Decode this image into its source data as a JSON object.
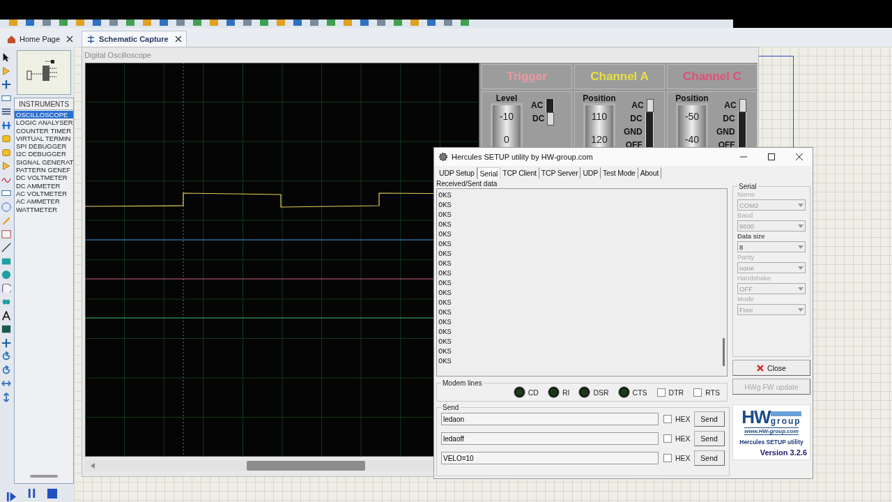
{
  "tabs": [
    {
      "label": "Home Page",
      "selected": false
    },
    {
      "label": "Schematic Capture",
      "selected": true
    }
  ],
  "instruments": {
    "title": "INSTRUMENTS",
    "items": [
      {
        "label": "OSCILLOSCOPE",
        "selected": true
      },
      {
        "label": "LOGIC ANALYSER",
        "selected": false
      },
      {
        "label": "COUNTER TIMER",
        "selected": false
      },
      {
        "label": "VIRTUAL TERMIN",
        "selected": false
      },
      {
        "label": "SPI DEBUGGER",
        "selected": false
      },
      {
        "label": "I2C DEBUGGER",
        "selected": false
      },
      {
        "label": "SIGNAL GENERAT",
        "selected": false
      },
      {
        "label": "PATTERN GENEF",
        "selected": false
      },
      {
        "label": "DC VOLTMETER",
        "selected": false
      },
      {
        "label": "DC AMMETER",
        "selected": false
      },
      {
        "label": "AC VOLTMETER",
        "selected": false
      },
      {
        "label": "AC AMMETER",
        "selected": false
      },
      {
        "label": "WATTMETER",
        "selected": false
      }
    ]
  },
  "oscilloscope": {
    "title": "Digital Oscilloscope",
    "panels": [
      {
        "title": "Trigger",
        "color": "#e89aa0",
        "knob_label": "Level",
        "scale": [
          "-10",
          "0"
        ],
        "coupling": [
          {
            "label": "AC",
            "selected": false
          },
          {
            "label": "DC",
            "selected": true
          }
        ]
      },
      {
        "title": "Channel A",
        "color": "#e8e040",
        "knob_label": "Position",
        "scale": [
          "110",
          "120"
        ],
        "coupling": [
          {
            "label": "AC",
            "selected": true
          },
          {
            "label": "DC",
            "selected": false
          },
          {
            "label": "GND",
            "selected": false
          },
          {
            "label": "OFF",
            "selected": false
          }
        ]
      },
      {
        "title": "Channel C",
        "color": "#e0507a",
        "knob_label": "Position",
        "scale": [
          "-50",
          "-40"
        ],
        "coupling": [
          {
            "label": "AC",
            "selected": true
          },
          {
            "label": "DC",
            "selected": false
          },
          {
            "label": "GND",
            "selected": false
          },
          {
            "label": "OFF",
            "selected": false
          }
        ]
      }
    ]
  },
  "hercules": {
    "title": "Hercules SETUP utility by HW-group.com",
    "tabs": [
      {
        "label": "UDP Setup",
        "selected": false
      },
      {
        "label": "Serial",
        "selected": true
      },
      {
        "label": "TCP Client",
        "selected": false
      },
      {
        "label": "TCP Server",
        "selected": false
      },
      {
        "label": "UDP",
        "selected": false
      },
      {
        "label": "Test Mode",
        "selected": false
      },
      {
        "label": "About",
        "selected": false
      }
    ],
    "received_label": "Received/Sent data",
    "received_lines": [
      "OKS",
      "OKS",
      "OKS",
      "OKS",
      "OKS",
      "OKS",
      "OKS",
      "OKS",
      "OKS",
      "OKS",
      "OKS",
      "OKS",
      "OKS",
      "OKS",
      "OKS",
      "OKS",
      "OKS",
      "OKS"
    ],
    "serial": {
      "title": "Serial",
      "fields": [
        {
          "label": "Name",
          "value": "COM2",
          "disabled": true
        },
        {
          "label": "Baud",
          "value": "9600",
          "disabled": true
        },
        {
          "label": "Data size",
          "value": "8",
          "disabled": false
        },
        {
          "label": "Parity",
          "value": "none",
          "disabled": true
        },
        {
          "label": "Handshake",
          "value": "OFF",
          "disabled": true
        },
        {
          "label": "Mode",
          "value": "Free",
          "disabled": true
        }
      ]
    },
    "close_button": "Close",
    "fw_button": {
      "label": "HWg FW update",
      "disabled": true
    },
    "modem_lines": {
      "title": "Modem lines",
      "indicators": [
        {
          "kind": "led",
          "label": "CD"
        },
        {
          "kind": "led",
          "label": "RI"
        },
        {
          "kind": "led",
          "label": "DSR"
        },
        {
          "kind": "led",
          "label": "CTS"
        },
        {
          "kind": "checkbox",
          "label": "DTR",
          "checked": false
        },
        {
          "kind": "checkbox",
          "label": "RTS",
          "checked": false
        }
      ]
    },
    "send": {
      "title": "Send",
      "rows": [
        {
          "value": "ledaon",
          "hex_label": "HEX",
          "hex": false,
          "button": "Send"
        },
        {
          "value": "ledaoff",
          "hex_label": "HEX",
          "hex": false,
          "button": "Send"
        },
        {
          "value": "VELO=10",
          "hex_label": "HEX",
          "hex": false,
          "button": "Send"
        }
      ]
    },
    "logo": {
      "brand": "HW",
      "brand_sub": "group",
      "url": "www.HW-group.com",
      "product": "Hercules SETUP utility",
      "version": "Version  3.2.6"
    }
  }
}
